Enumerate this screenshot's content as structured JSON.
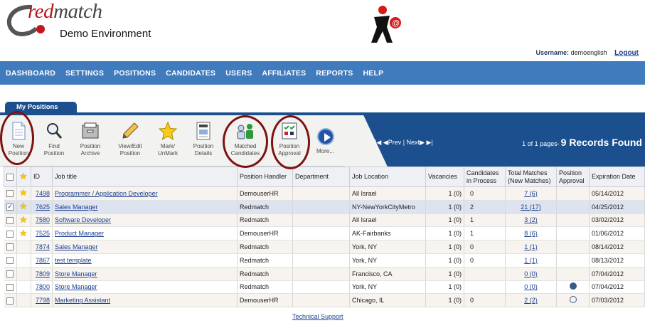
{
  "brand": {
    "logo_text_a": "red",
    "logo_text_b": "match",
    "subtitle": "Demo Environment"
  },
  "user": {
    "label": "Username:",
    "name": "demoenglish",
    "logout": "Logout"
  },
  "nav": [
    "DASHBOARD",
    "SETTINGS",
    "POSITIONS",
    "CANDIDATES",
    "USERS",
    "AFFILIATES",
    "REPORTS",
    "HELP"
  ],
  "tab": "My Positions",
  "toolbar": {
    "new": "New\nPosition",
    "find": "Find\nPosition",
    "archive": "Position\nArchive",
    "view": "View/Edit\nPosition",
    "mark": "Mark/\nUnMark",
    "details": "Position\nDetails",
    "matched": "Matched\nCandidates",
    "approval": "Position\nApproval",
    "more": "More..."
  },
  "pager": {
    "prev": "Prev",
    "next": "Next",
    "pages": "1 of 1 pages-",
    "records": "9 Records Found"
  },
  "columns": {
    "id": "ID",
    "title": "Job title",
    "handler": "Position Handler",
    "dept": "Department",
    "location": "Job Location",
    "vac": "Vacancies",
    "inproc": "Candidates in Process",
    "matches": "Total Matches (New Matches)",
    "approval": "Position Approval",
    "exp": "Expiration Date"
  },
  "rows": [
    {
      "star": true,
      "checked": false,
      "id": "7498",
      "title": "Programmer / Application Developer",
      "handler": "DemouserHR",
      "dept": "",
      "loc": "All Israel",
      "vac": "1 (0)",
      "inproc": "0",
      "matches": "7 (6)",
      "approval": "",
      "exp": "05/14/2012"
    },
    {
      "star": true,
      "checked": true,
      "id": "7625",
      "title": "Sales Manager",
      "handler": "Redmatch",
      "dept": "",
      "loc": "NY-NewYorkCityMetro",
      "vac": "1 (0)",
      "inproc": "2",
      "matches": "21 (17)",
      "approval": "",
      "exp": "04/25/2012"
    },
    {
      "star": true,
      "checked": false,
      "id": "7580",
      "title": "Software Developer",
      "handler": "Redmatch",
      "dept": "",
      "loc": "All Israel",
      "vac": "1 (0)",
      "inproc": "1",
      "matches": "3 (2)",
      "approval": "",
      "exp": "03/02/2012"
    },
    {
      "star": true,
      "checked": false,
      "id": "7525",
      "title": "Product Manager",
      "handler": "DemouserHR",
      "dept": "",
      "loc": "AK-Fairbanks",
      "vac": "1 (0)",
      "inproc": "1",
      "matches": "8 (6)",
      "approval": "",
      "exp": "01/06/2012"
    },
    {
      "star": false,
      "checked": false,
      "id": "7874",
      "title": "Sales Manager",
      "handler": "Redmatch",
      "dept": "",
      "loc": "York, NY",
      "vac": "1 (0)",
      "inproc": "0",
      "matches": "1 (1)",
      "approval": "",
      "exp": "08/14/2012"
    },
    {
      "star": false,
      "checked": false,
      "id": "7867",
      "title": "test template",
      "handler": "Redmatch",
      "dept": "",
      "loc": "York, NY",
      "vac": "1 (0)",
      "inproc": "0",
      "matches": "1 (1)",
      "approval": "",
      "exp": "08/13/2012"
    },
    {
      "star": false,
      "checked": false,
      "id": "7809",
      "title": "Store Manager",
      "handler": "Redmatch",
      "dept": "",
      "loc": "Francisco, CA",
      "vac": "1 (0)",
      "inproc": "",
      "matches": "0 (0)",
      "approval": "",
      "exp": "07/04/2012"
    },
    {
      "star": false,
      "checked": false,
      "id": "7800",
      "title": "Store Manager",
      "handler": "Redmatch",
      "dept": "",
      "loc": "York, NY",
      "vac": "1 (0)",
      "inproc": "",
      "matches": "0 (0)",
      "approval": "approved",
      "exp": "07/04/2012"
    },
    {
      "star": false,
      "checked": false,
      "id": "7798",
      "title": "Marketing Assistant",
      "handler": "DemouserHR",
      "dept": "",
      "loc": "Chicago, IL",
      "vac": "1 (0)",
      "inproc": "0",
      "matches": "2 (2)",
      "approval": "pending",
      "exp": "07/03/2012"
    }
  ],
  "footer": "Technical Support"
}
